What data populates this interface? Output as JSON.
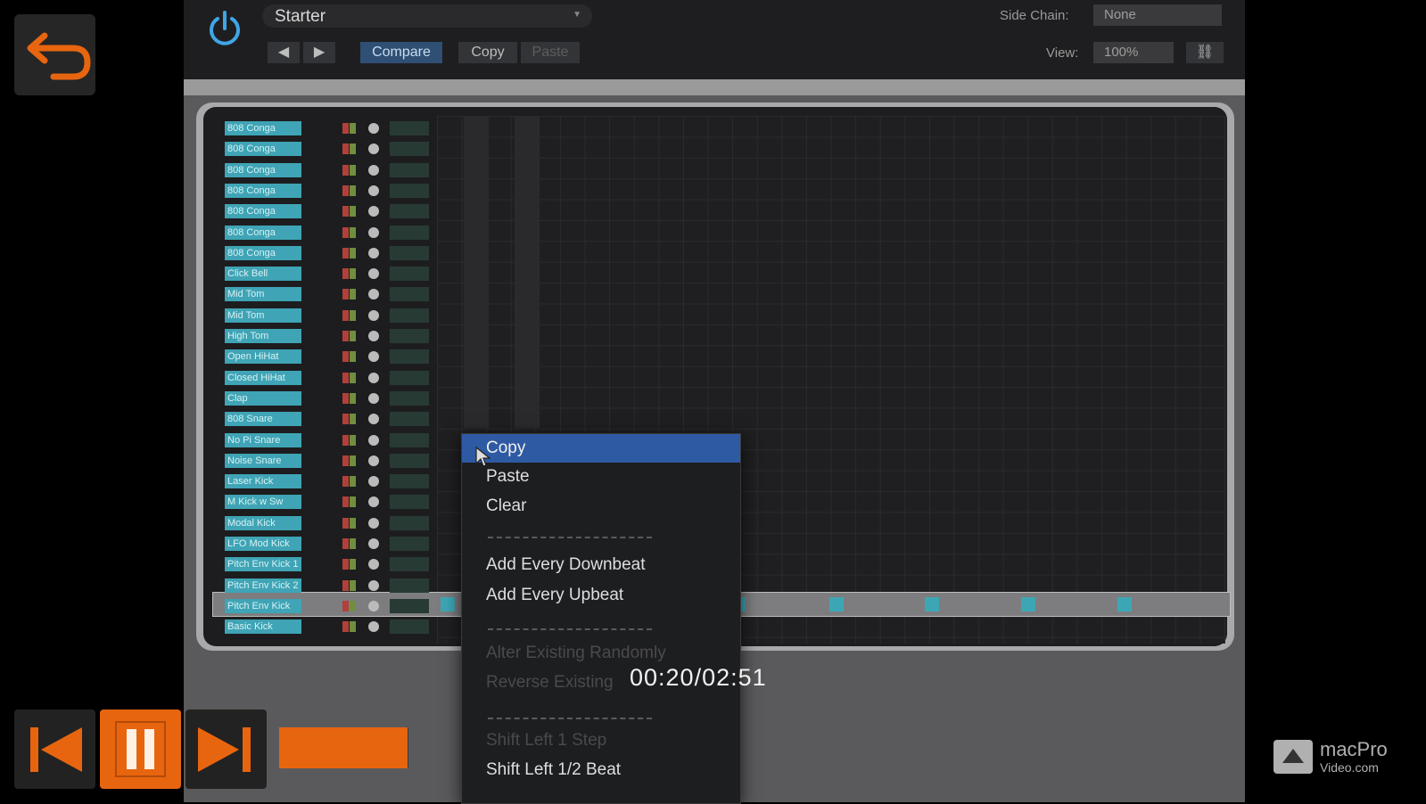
{
  "plugin": {
    "preset_name": "Starter",
    "prev_label": "◀",
    "next_label": "▶",
    "compare_label": "Compare",
    "copy_label": "Copy",
    "paste_label": "Paste",
    "side_chain_label": "Side Chain:",
    "side_chain_value": "None",
    "view_label": "View:",
    "view_value": "100%"
  },
  "tracks": [
    {
      "name": "808 Conga"
    },
    {
      "name": "808 Conga"
    },
    {
      "name": "808 Conga"
    },
    {
      "name": "808 Conga"
    },
    {
      "name": "808 Conga"
    },
    {
      "name": "808 Conga"
    },
    {
      "name": "808 Conga"
    },
    {
      "name": "Click Bell"
    },
    {
      "name": "Mid Tom"
    },
    {
      "name": "Mid Tom"
    },
    {
      "name": "High Tom"
    },
    {
      "name": "Open HiHat"
    },
    {
      "name": "Closed HiHat"
    },
    {
      "name": "Clap"
    },
    {
      "name": "808 Snare"
    },
    {
      "name": "No Pi Snare"
    },
    {
      "name": "Noise Snare"
    },
    {
      "name": "Laser Kick"
    },
    {
      "name": "M Kick w Sw"
    },
    {
      "name": "Modal Kick"
    },
    {
      "name": "LFO Mod Kick"
    },
    {
      "name": "Pitch Env Kick 1"
    },
    {
      "name": "Pitch Env Kick 2"
    },
    {
      "name": "Pitch Env Kick"
    },
    {
      "name": "Basic Kick"
    }
  ],
  "context_menu": {
    "items": [
      {
        "label": "Copy",
        "state": "highlighted"
      },
      {
        "label": "Paste",
        "state": "enabled"
      },
      {
        "label": "Clear",
        "state": "enabled"
      },
      {
        "label": "Add Every Downbeat",
        "state": "enabled"
      },
      {
        "label": "Add Every Upbeat",
        "state": "enabled"
      },
      {
        "label": "Alter Existing Randomly",
        "state": "disabled"
      },
      {
        "label": "Reverse Existing",
        "state": "disabled"
      },
      {
        "label": "Shift Left 1 Step",
        "state": "disabled"
      },
      {
        "label": "Shift Left 1/2 Beat",
        "state": "enabled"
      }
    ]
  },
  "player": {
    "timecode": "00:20/02:51",
    "progress": 0.117,
    "brand": "macProVideo.com"
  },
  "colors": {
    "accent_orange": "#e8650f",
    "menu_highlight": "#2e5aa3",
    "track_teal": "#3fa4b5",
    "power_blue": "#3fa6e6"
  }
}
